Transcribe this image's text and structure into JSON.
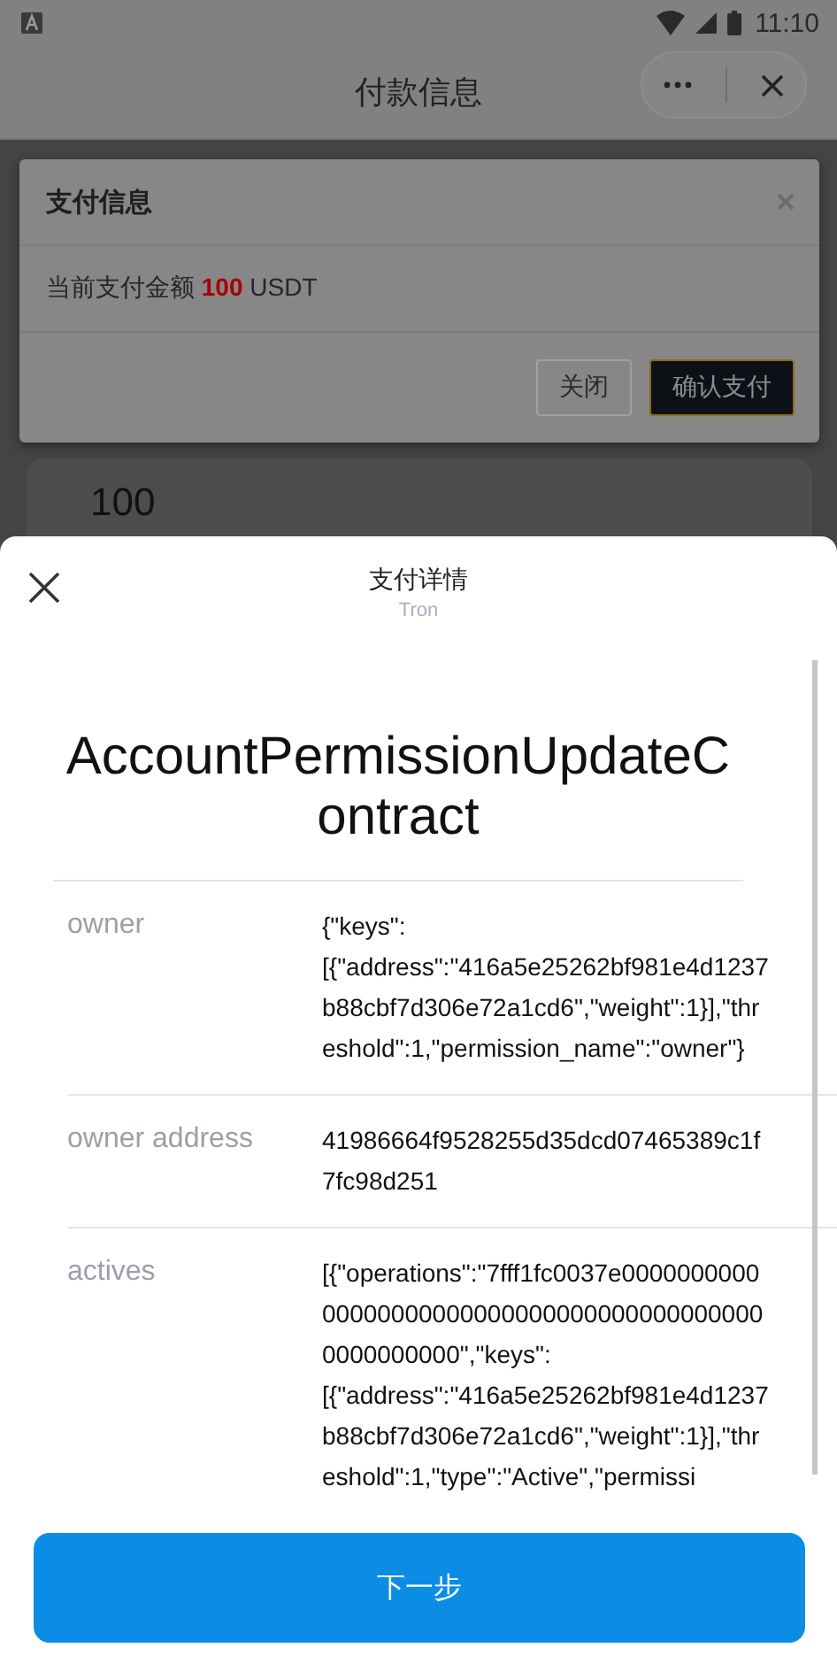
{
  "status_bar": {
    "time": "11:10"
  },
  "nav": {
    "title": "付款信息"
  },
  "dialog": {
    "title": "支付信息",
    "message": "当前支付金额 **100** USDT",
    "buttons": [
      {
        "label": "关闭",
        "kind": "secondary"
      },
      {
        "label": "确认支付",
        "kind": "primary"
      }
    ]
  },
  "background_card": {
    "amount": "100"
  },
  "sheet": {
    "title": "支付详情",
    "subtitle": "Tron",
    "contract": "AccountPermissionUpdateContract",
    "rows": [
      {
        "label": "owner",
        "value": "{\"keys\":[{\"address\":\"416a5e25262bf981e4d1237b88cbf7d306e72a1cd6\",\"weight\":1}],\"threshold\":1,\"permission_name\":\"owner\"}"
      },
      {
        "label": "owner address",
        "value": "41986664f9528255d35dcd07465389c1f7fc98d251"
      },
      {
        "label": "actives",
        "value": "[{\"operations\":\"7fff1fc0037e0000000000000000000000000000000000000000000000000000\",\"keys\":[{\"address\":\"416a5e25262bf981e4d1237b88cbf7d306e72a1cd6\",\"weight\":1}],\"threshold\":1,\"type\":\"Active\",\"permissi"
      }
    ],
    "button": "下一步"
  }
}
